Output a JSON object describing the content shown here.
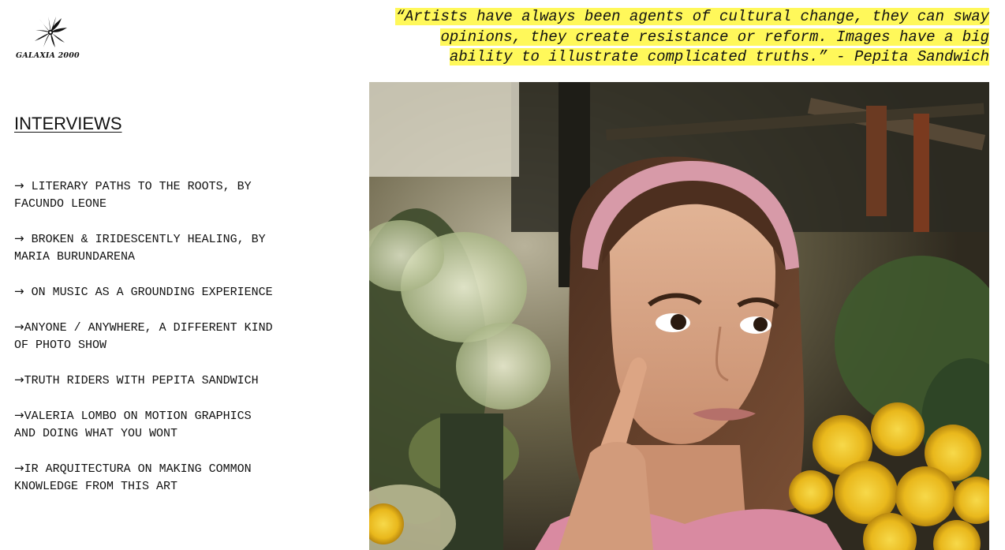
{
  "brand": {
    "logo_text": "GALAXIA 2000",
    "logo_icon": "spiral-swirl-icon"
  },
  "section": {
    "title": "INTERVIEWS"
  },
  "interviews": [
    {
      "arrow": "→",
      "title": "LITERARY PATHS TO THE ROOTS, BY FACUNDO LEONE",
      "spaced": true
    },
    {
      "arrow": "→",
      "title": "BROKEN & IRIDESCENTLY HEALING, BY MARIA BURUNDARENA",
      "spaced": true
    },
    {
      "arrow": "→",
      "title": "ON MUSIC AS A GROUNDING EXPERIENCE",
      "spaced": true
    },
    {
      "arrow": "→",
      "title": "ANYONE / ANYWHERE, A DIFFERENT KIND OF PHOTO SHOW",
      "spaced": false
    },
    {
      "arrow": "→",
      "title": "TRUTH RIDERS WITH PEPITA SANDWICH",
      "spaced": false
    },
    {
      "arrow": "→",
      "title": "VALERIA LOMBO ON MOTION GRAPHICS AND DOING WHAT YOU WONT",
      "spaced": false
    },
    {
      "arrow": "→",
      "title": "IR ARQUITECTURA ON MAKING COMMON KNOWLEDGE FROM THIS ART",
      "spaced": false
    }
  ],
  "quote": {
    "text": "“Artists have always been agents of cultural change, they can sway opinions, they create resistance or reform. Images have a big ability to illustrate complicated truths.” - Pepita Sandwich",
    "highlight_color": "#fff85a"
  },
  "photo": {
    "subject": "portrait of woman with pink headband touching cheek among flowers"
  },
  "colors": {
    "text": "#111111",
    "background": "#ffffff",
    "highlight": "#fff85a"
  }
}
